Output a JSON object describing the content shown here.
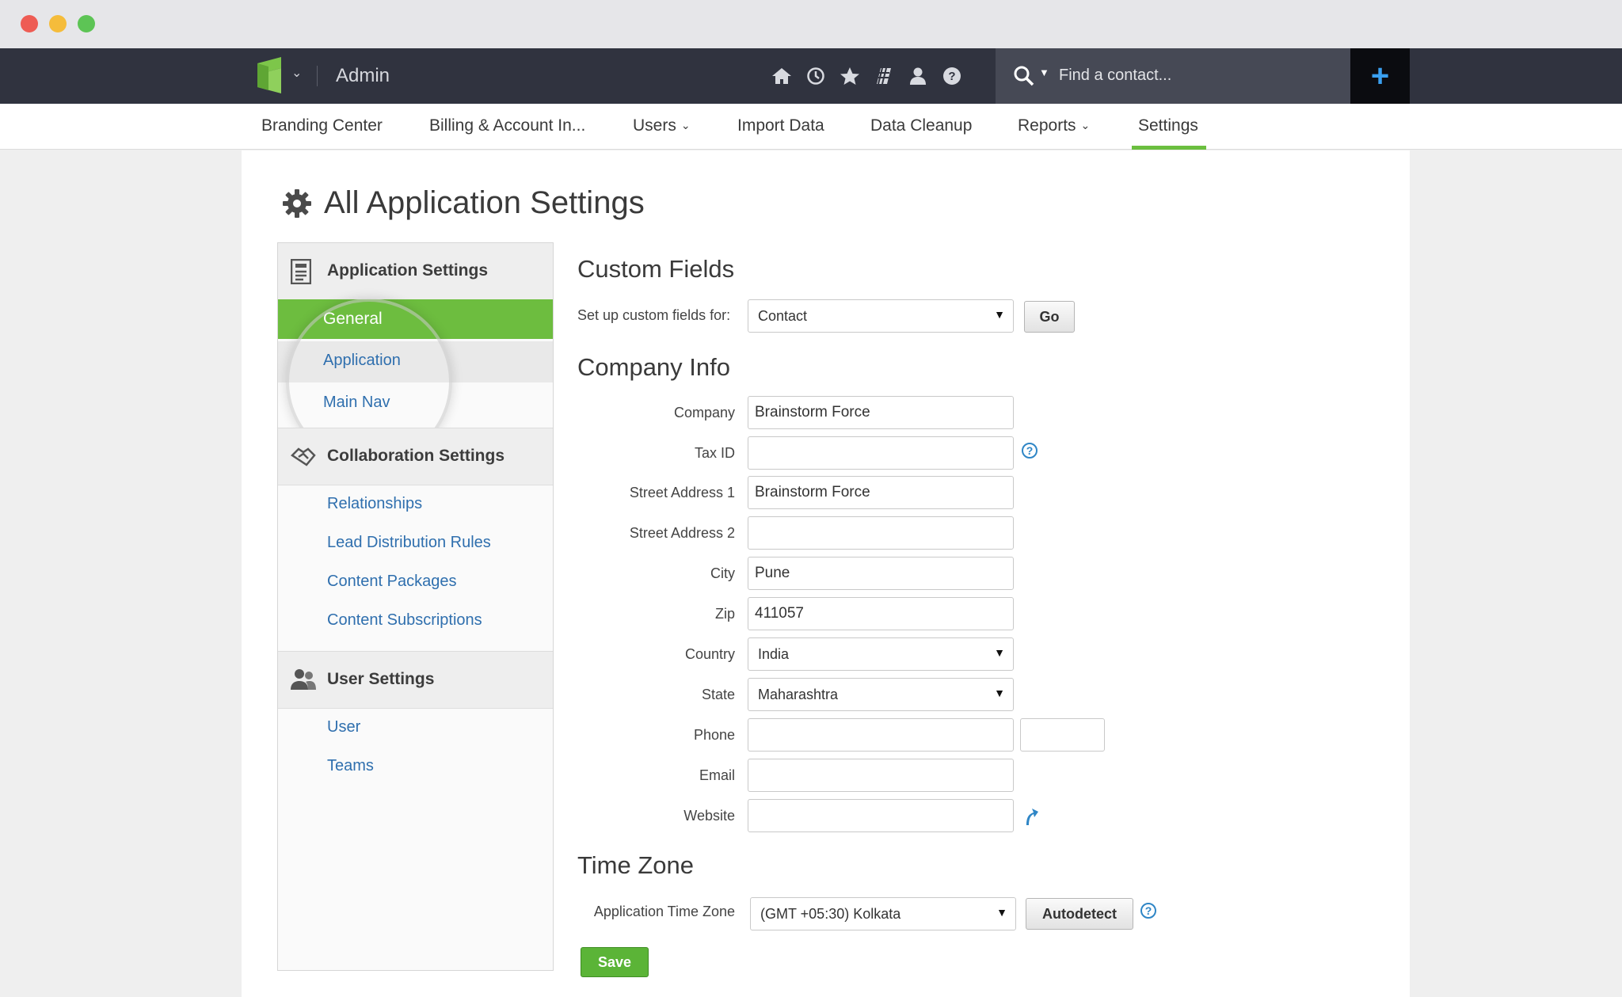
{
  "window": {
    "controls": [
      "close",
      "minimize",
      "maximize"
    ]
  },
  "topbar": {
    "title": "Admin",
    "icons": [
      "home-icon",
      "clock-icon",
      "star-icon",
      "flag-icon",
      "user-icon",
      "help-icon"
    ],
    "search": {
      "placeholder": "Find a contact..."
    },
    "add_label": "+"
  },
  "subnav": {
    "items": [
      {
        "label": "Branding Center"
      },
      {
        "label": "Billing & Account In..."
      },
      {
        "label": "Users",
        "dropdown": true
      },
      {
        "label": "Import Data"
      },
      {
        "label": "Data Cleanup"
      },
      {
        "label": "Reports",
        "dropdown": true
      },
      {
        "label": "Settings",
        "active": true
      }
    ],
    "chevron": "⌄"
  },
  "page": {
    "title": "All Application Settings"
  },
  "sidebar": {
    "sections": [
      {
        "title": "Application Settings",
        "items": [
          {
            "label": "General",
            "active": true
          },
          {
            "label": "Application"
          },
          {
            "label": "Main Nav"
          }
        ]
      },
      {
        "title": "Collaboration Settings",
        "items": [
          {
            "label": "Relationships"
          },
          {
            "label": "Lead Distribution Rules"
          },
          {
            "label": "Content Packages"
          },
          {
            "label": "Content Subscriptions"
          }
        ]
      },
      {
        "title": "User Settings",
        "items": [
          {
            "label": "User"
          },
          {
            "label": "Teams"
          }
        ]
      }
    ]
  },
  "custom_fields": {
    "heading": "Custom Fields",
    "label": "Set up custom fields for:",
    "selected": "Contact",
    "go_label": "Go"
  },
  "company_info": {
    "heading": "Company Info",
    "company": {
      "label": "Company",
      "value": "Brainstorm Force"
    },
    "tax_id": {
      "label": "Tax ID",
      "value": ""
    },
    "street1": {
      "label": "Street Address 1",
      "value": "Brainstorm Force"
    },
    "street2": {
      "label": "Street Address 2",
      "value": ""
    },
    "city": {
      "label": "City",
      "value": "Pune"
    },
    "zip": {
      "label": "Zip",
      "value": "411057"
    },
    "country": {
      "label": "Country",
      "value": "India"
    },
    "state": {
      "label": "State",
      "value": "Maharashtra"
    },
    "phone": {
      "label": "Phone",
      "value": "",
      "ext": ""
    },
    "email": {
      "label": "Email",
      "value": ""
    },
    "website": {
      "label": "Website",
      "value": ""
    }
  },
  "time_zone": {
    "heading": "Time Zone",
    "label": "Application Time Zone",
    "selected": "(GMT +05:30) Kolkata",
    "autodetect_label": "Autodetect"
  },
  "save_label": "Save",
  "colors": {
    "topbar": "#30333f",
    "accent_green": "#6dbd3f",
    "link_blue": "#2f6fae",
    "plus_blue": "#3aa0f0"
  }
}
